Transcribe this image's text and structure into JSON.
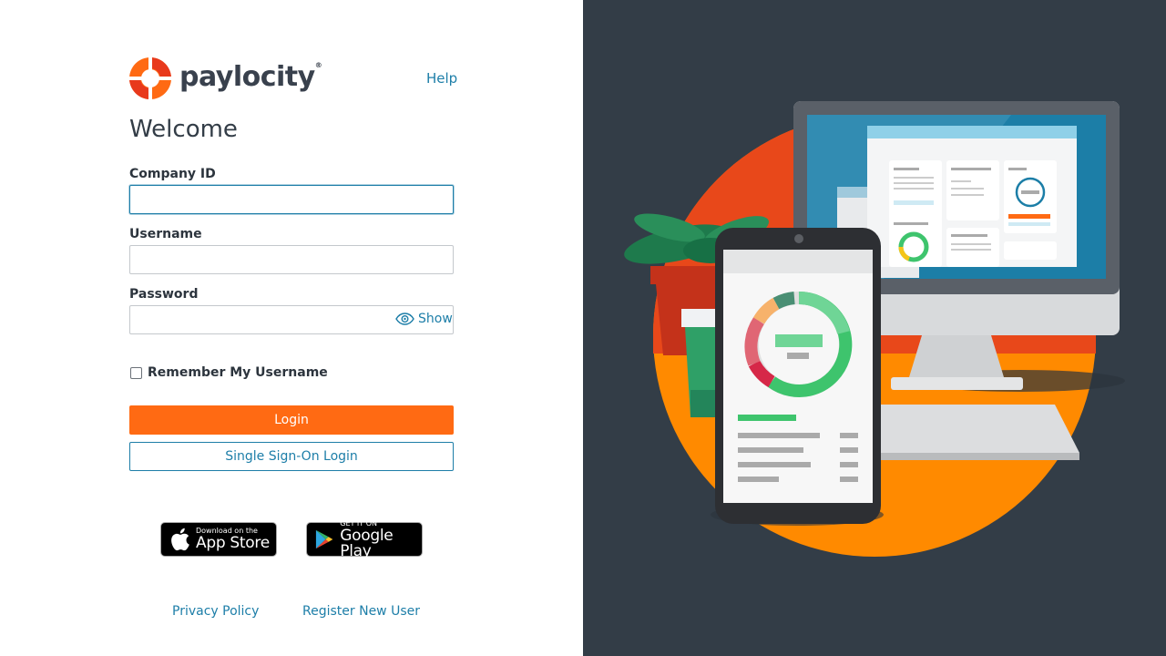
{
  "brand": {
    "name": "paylocity",
    "trademark": "®",
    "colors": {
      "orange": "#ff6a13",
      "red": "#e8391c",
      "blue_link": "#1d7ea8",
      "dark_panel": "#333d47"
    }
  },
  "header": {
    "help_label": "Help"
  },
  "form": {
    "title": "Welcome",
    "company_id": {
      "label": "Company ID",
      "value": "",
      "placeholder": ""
    },
    "username": {
      "label": "Username",
      "value": "",
      "placeholder": ""
    },
    "password": {
      "label": "Password",
      "value": "",
      "placeholder": "",
      "show_label": "Show"
    },
    "remember": {
      "label": "Remember My Username",
      "checked": false
    },
    "login_label": "Login",
    "sso_label": "Single Sign-On Login"
  },
  "stores": {
    "apple": {
      "small": "Download on the",
      "big": "App Store"
    },
    "google": {
      "small": "GET IT ON",
      "big": "Google Play"
    }
  },
  "footer": {
    "privacy_label": "Privacy Policy",
    "register_label": "Register New User"
  },
  "illustration": {
    "icons": [
      "monitor",
      "smartphone",
      "donut-chart",
      "potted-plant",
      "coffee-cup"
    ]
  }
}
